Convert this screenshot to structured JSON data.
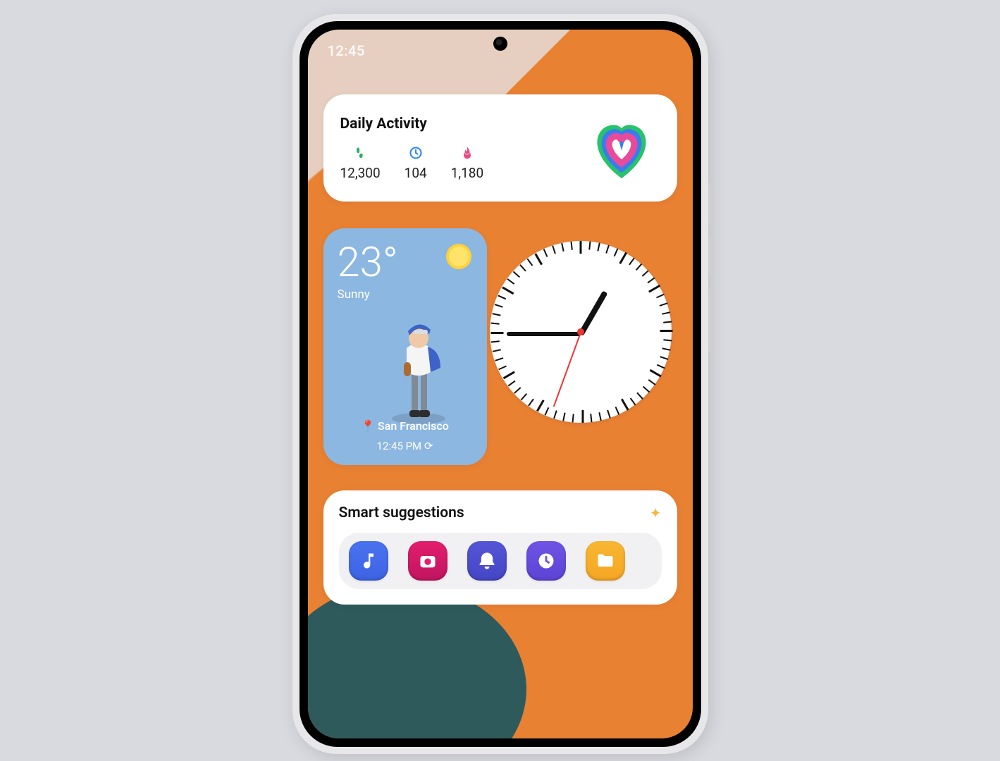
{
  "status": {
    "time": "12:45"
  },
  "daily": {
    "title": "Daily Activity",
    "steps": {
      "icon_color": "#27ae60",
      "value": "12,300"
    },
    "minutes": {
      "icon_color": "#2e86f0",
      "value": "104"
    },
    "calories": {
      "icon_color": "#e94b7f",
      "value": "1,180"
    }
  },
  "weather": {
    "temperature": "23°",
    "condition": "Sunny",
    "location": "San Francisco",
    "time": "12:45 PM"
  },
  "clock": {
    "hour_angle": -60,
    "minute_angle": 180,
    "second_angle": 110
  },
  "suggestions": {
    "title": "Smart suggestions",
    "apps": [
      {
        "name": "music",
        "color": "c-blue"
      },
      {
        "name": "camera",
        "color": "c-magenta"
      },
      {
        "name": "reminder",
        "color": "c-indigo"
      },
      {
        "name": "clock",
        "color": "c-violet"
      },
      {
        "name": "files",
        "color": "c-amber"
      }
    ]
  }
}
